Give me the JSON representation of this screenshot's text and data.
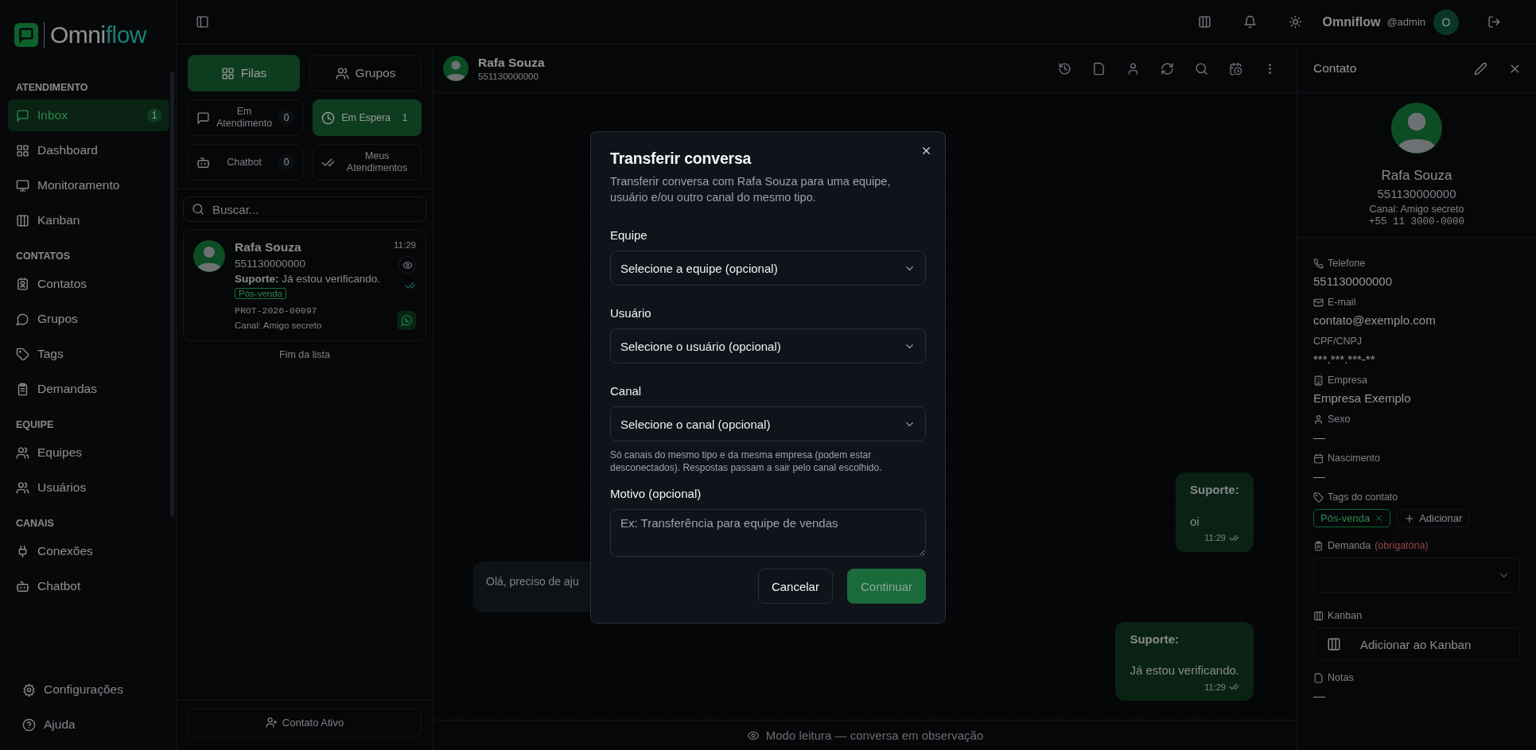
{
  "logo": {
    "word_start": "Omni",
    "word_end": "flow"
  },
  "sidebar": {
    "sections": [
      {
        "title": "ATENDIMENTO",
        "items": [
          {
            "label": "Inbox",
            "selected": true,
            "badge": "1"
          },
          {
            "label": "Dashboard",
            "selected": false
          },
          {
            "label": "Monitoramento",
            "selected": false
          },
          {
            "label": "Kanban",
            "selected": false
          }
        ]
      },
      {
        "title": "CONTATOS",
        "items": [
          {
            "label": "Contatos",
            "selected": false
          },
          {
            "label": "Grupos",
            "selected": false
          },
          {
            "label": "Tags",
            "selected": false
          },
          {
            "label": "Demandas",
            "selected": false
          }
        ]
      },
      {
        "title": "EQUIPE",
        "items": [
          {
            "label": "Equipes",
            "selected": false
          },
          {
            "label": "Usuários",
            "selected": false
          }
        ]
      },
      {
        "title": "CANAIS",
        "items": [
          {
            "label": "Conexões",
            "selected": false
          },
          {
            "label": "Chatbot",
            "selected": false
          }
        ]
      }
    ],
    "footer_items": [
      {
        "label": "Configurações"
      },
      {
        "label": "Ajuda"
      }
    ]
  },
  "topbar": {
    "user_name": "Omniflow",
    "user_handle": "@admin",
    "avatar_initial": "O"
  },
  "queue": {
    "view_tabs": [
      {
        "label": "Filas",
        "selected": true
      },
      {
        "label": "Grupos",
        "selected": false
      }
    ],
    "filters": [
      {
        "label": "Em Atendimento",
        "count": "0",
        "selected": false
      },
      {
        "label": "Em Espera",
        "count": "1",
        "selected": true
      },
      {
        "label": "Chatbot",
        "count": "0",
        "selected": false
      },
      {
        "label": "Meus Atendimentos",
        "selected": false
      }
    ],
    "search": {
      "placeholder": "Buscar..."
    },
    "conversations": [
      {
        "name": "Rafa Souza",
        "phone": "551130000000",
        "time": "11:29",
        "last_message": "**Suporte:** Já estou verificando.",
        "tag": "Pós-venda",
        "protocol": "PROT-2026-00097",
        "channel": "Canal: Amigo secreto"
      }
    ],
    "end_label": "Fim da lista",
    "new_contact_button": "Contato Ativo"
  },
  "chat": {
    "contact_name": "Rafa Souza",
    "contact_phone": "551130000000",
    "messages": [
      {
        "kind": "outgoing",
        "sender": "Suporte:",
        "text": "oi",
        "time": "11:29"
      },
      {
        "kind": "incoming",
        "text": "Olá, preciso de aju"
      },
      {
        "kind": "outgoing",
        "sender": "Suporte:",
        "text": "Já estou verificando.",
        "time": "11:29"
      }
    ],
    "read_only_notice": "Modo leitura — conversa em observação"
  },
  "contact_panel": {
    "title": "Contato",
    "name": "Rafa Souza",
    "phone": "551130000000",
    "channel": "Canal: Amigo secreto",
    "phone_formatted": "+55 11 3000-0000",
    "fields": [
      {
        "label": "Telefone",
        "value": "551130000000"
      },
      {
        "label": "E-mail",
        "value": "contato@exemplo.com"
      },
      {
        "label": "CPF/CNPJ",
        "value": "***.***.***-**"
      },
      {
        "label": "Empresa",
        "value": "Empresa Exemplo"
      },
      {
        "label": "Sexo",
        "value": "—"
      },
      {
        "label": "Nascimento",
        "value": "—"
      }
    ],
    "tags_label": "Tags do contato",
    "tags": [
      {
        "label": "Pós-venda"
      }
    ],
    "add_tag_button": "Adicionar",
    "demand_label": "Demanda",
    "demand_required": "(obrigatória)",
    "kanban_label": "Kanban",
    "kanban_button": "Adicionar ao Kanban",
    "notes_label": "Notas",
    "notes_value": "—"
  },
  "modal": {
    "title": "Transferir conversa",
    "description": "Transferir conversa com Rafa Souza para uma equipe, usuário e/ou outro canal do mesmo tipo.",
    "fields": [
      {
        "kind": "select",
        "label": "Equipe",
        "value": "Selecione a equipe (opcional)"
      },
      {
        "kind": "select",
        "label": "Usuário",
        "value": "Selecione o usuário (opcional)"
      },
      {
        "kind": "select",
        "label": "Canal",
        "value": "Selecione o canal (opcional)",
        "hint": "Só canais do mesmo tipo e da mesma empresa (podem estar desconectados). Respostas passam a sair pelo canal escolhido."
      },
      {
        "kind": "textarea",
        "label": "Motivo (opcional)",
        "placeholder": "Ex: Transferência para equipe de vendas"
      }
    ],
    "buttons": [
      {
        "label": "Cancelar",
        "kind": "secondary",
        "disabled": false
      },
      {
        "label": "Continuar",
        "kind": "primary",
        "disabled": true
      }
    ]
  }
}
